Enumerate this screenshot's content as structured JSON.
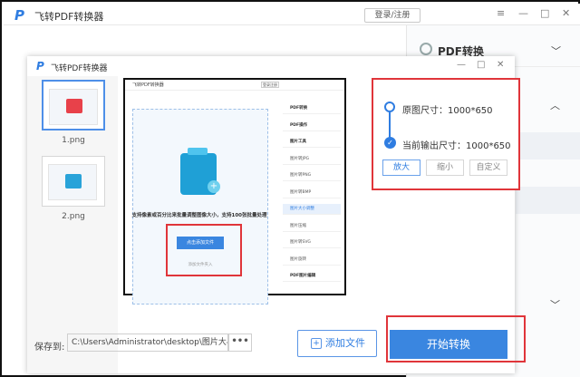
{
  "app": {
    "logo": "P",
    "title": "飞转PDF转换器",
    "login_label": "登录/注册",
    "controls": [
      "≡",
      "—",
      "□",
      "✕"
    ]
  },
  "right_panel": {
    "section1_title": "PDF转换"
  },
  "dialog": {
    "logo": "P",
    "title": "飞转PDF转换器",
    "controls": [
      "—",
      "□",
      "✕"
    ],
    "thumbnails": [
      {
        "label": "1.png",
        "folder_color": "#e8414a"
      },
      {
        "label": "2.png",
        "folder_color": "#29a3d9"
      }
    ],
    "preview": {
      "title": "飞转PDF转换器",
      "btn": "登录注册",
      "drop_text": "支持像素或百分比来批量调整图像大小，支持100张批量处理",
      "add_button": "点击添加文件",
      "add_link": "添加文件夹入",
      "sidebar": [
        {
          "label": "PDF转换",
          "type": "hd"
        },
        {
          "label": "PDF操作",
          "type": "hd"
        },
        {
          "label": "图片工具",
          "type": "hd"
        },
        {
          "label": "图片转JPG",
          "type": ""
        },
        {
          "label": "图片转PNG",
          "type": ""
        },
        {
          "label": "图片转BMP",
          "type": ""
        },
        {
          "label": "图片大小调整",
          "type": "sel"
        },
        {
          "label": "图片压缩",
          "type": ""
        },
        {
          "label": "图片转SVG",
          "type": ""
        },
        {
          "label": "图片旋转",
          "type": ""
        },
        {
          "label": "PDF图片编辑",
          "type": "hd"
        }
      ]
    },
    "save_label": "保存到:",
    "save_path": "C:\\Users\\Administrator\\desktop\\图片大小调整",
    "browse_label": "•••",
    "add_file_label": "添加文件",
    "start_label": "开始转换"
  },
  "size_panel": {
    "original_label": "原图尺寸：1000*650",
    "output_label": "当前输出尺寸：1000*650",
    "buttons": [
      "放大",
      "缩小",
      "自定义"
    ]
  },
  "colors": {
    "accent": "#2f7de1",
    "highlight_box": "#e0353a"
  }
}
